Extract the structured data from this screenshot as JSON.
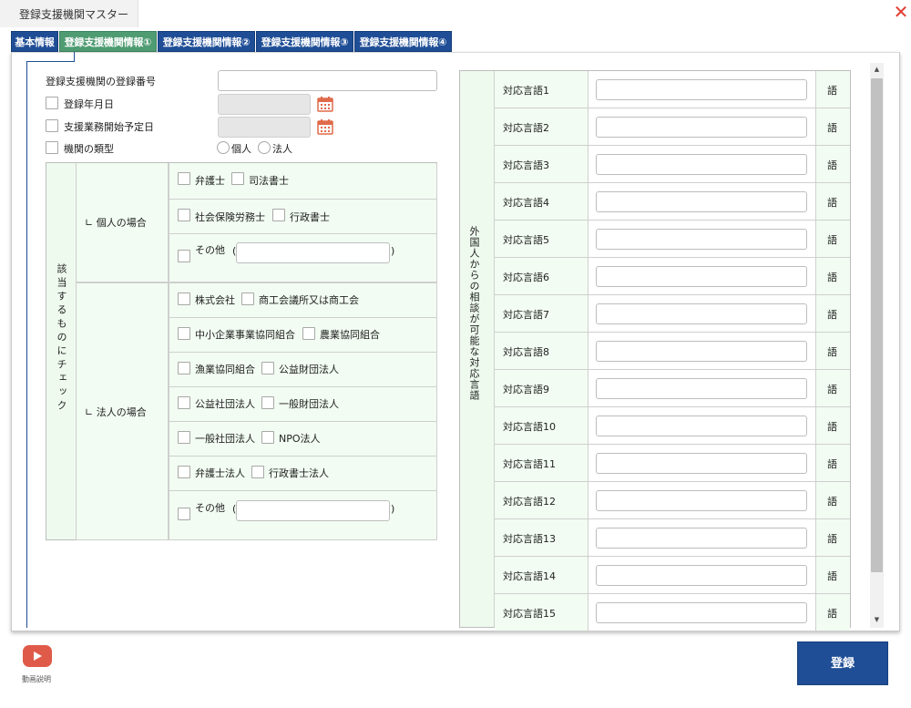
{
  "window": {
    "title": "登録支援機関マスター",
    "close_icon": "close-icon"
  },
  "tabs": [
    {
      "label": "基本情報"
    },
    {
      "label": "登録支援機関情報①"
    },
    {
      "label": "登録支援機関情報②"
    },
    {
      "label": "登録支援機関情報③"
    },
    {
      "label": "登録支援機関情報④"
    }
  ],
  "active_tab": 1,
  "fields": {
    "reg_number_label": "登録支援機関の登録番号",
    "reg_date_label": "登録年月日",
    "start_date_label": "支援業務開始予定日",
    "org_type_label": "機関の類型",
    "org_type_options": [
      "個人",
      "法人"
    ]
  },
  "applicable": {
    "side_label": "該当するものにチェック",
    "individual": {
      "label": "∟ 個人の場合",
      "rows": [
        [
          "弁護士",
          "司法書士"
        ],
        [
          "社会保険労務士",
          "行政書士"
        ]
      ],
      "other_label": "その他",
      "paren_open": "(",
      "paren_close": ")"
    },
    "corporate": {
      "label": "∟ 法人の場合",
      "rows": [
        [
          "株式会社",
          "商工会議所又は商工会"
        ],
        [
          "中小企業事業協同組合",
          "農業協同組合"
        ],
        [
          "漁業協同組合",
          "公益財団法人"
        ],
        [
          "公益社団法人",
          "一般財団法人"
        ],
        [
          "一般社団法人",
          "NPO法人"
        ],
        [
          "弁護士法人",
          "行政書士法人"
        ]
      ],
      "other_label": "その他",
      "paren_open": "(",
      "paren_close": ")"
    }
  },
  "languages": {
    "side_label": "外国人からの相談が可能な対応言語",
    "suffix": "語",
    "rows": [
      "対応言語1",
      "対応言語2",
      "対応言語3",
      "対応言語4",
      "対応言語5",
      "対応言語6",
      "対応言語7",
      "対応言語8",
      "対応言語9",
      "対応言語10",
      "対応言語11",
      "対応言語12",
      "対応言語13",
      "対応言語14",
      "対応言語15"
    ]
  },
  "footer": {
    "video_label": "動画説明",
    "submit_label": "登録"
  },
  "colors": {
    "tab_blue": "#1f4e96",
    "tab_active_green": "#4f9b72",
    "close_red": "#e03c31",
    "cell_green": "#f2fcf2",
    "calendar_red": "#e06a4a"
  }
}
